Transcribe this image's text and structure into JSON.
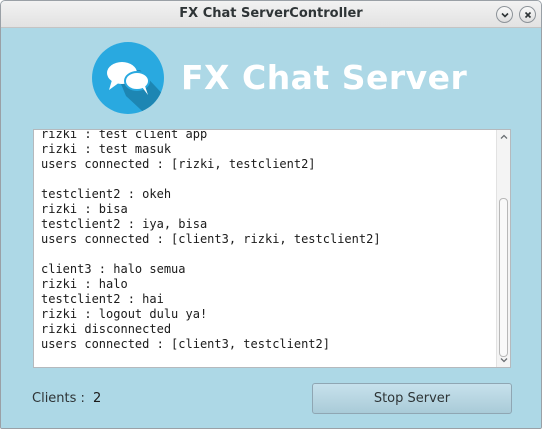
{
  "window": {
    "title": "FX Chat ServerController"
  },
  "header": {
    "app_title": "FX Chat Server",
    "logo_icon": "chat-bubbles-icon",
    "logo_color": "#29a9e0"
  },
  "log": {
    "lines": [
      "rizki : test client app",
      "rizki : test masuk",
      "users connected : [rizki, testclient2]",
      "",
      "testclient2 : okeh",
      "rizki : bisa",
      "testclient2 : iya, bisa",
      "users connected : [client3, rizki, testclient2]",
      "",
      "client3 : halo semua",
      "rizki : halo",
      "testclient2 : hai",
      "rizki : logout dulu ya!",
      "rizki disconnected",
      "users connected : [client3, testclient2]"
    ]
  },
  "footer": {
    "clients_label": "Clients :",
    "clients_count": "2",
    "stop_label": "Stop Server"
  },
  "colors": {
    "background": "#add8e6",
    "title_text": "#ffffff"
  }
}
